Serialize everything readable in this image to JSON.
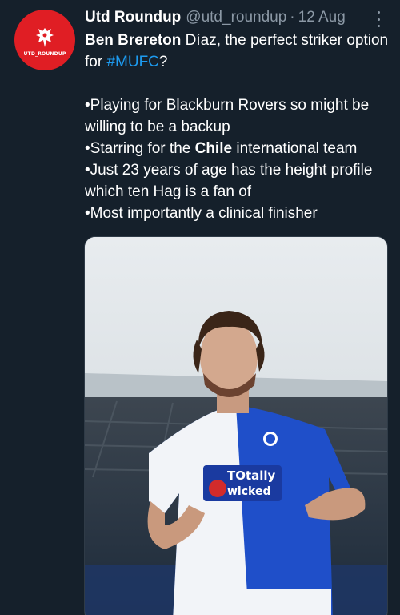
{
  "author": {
    "display_name": "Utd Roundup",
    "handle": "@utd_roundup",
    "separator": "·",
    "date": "12 Aug",
    "avatar_text": "UTD_ROUNDUP"
  },
  "tweet": {
    "line1_bold": "Ben Brereton",
    "line1_rest": " Díaz, the perfect striker option for ",
    "hashtag": "#MUFC",
    "line1_end": "?",
    "bullets": [
      "•Playing for Blackburn Rovers so might be willing to be a backup",
      "•Starring for the ",
      "•Just 23 years of age has the height profile which ten Hag is a fan of",
      "•Most importantly a clinical finisher"
    ],
    "bullet2_bold": "Chile",
    "bullet2_rest": " international team"
  },
  "media": {
    "shirt_sponsor_line1": "TOtally",
    "shirt_sponsor_line2": "wicked",
    "colors": {
      "shirt_blue": "#1f4fc9",
      "shirt_white": "#f2f4f8",
      "sky": "#dfe4e8"
    }
  },
  "colors": {
    "background": "#15202b",
    "secondary_text": "#8b98a5",
    "link": "#1d9bf0",
    "avatar_red": "#e01e24"
  }
}
